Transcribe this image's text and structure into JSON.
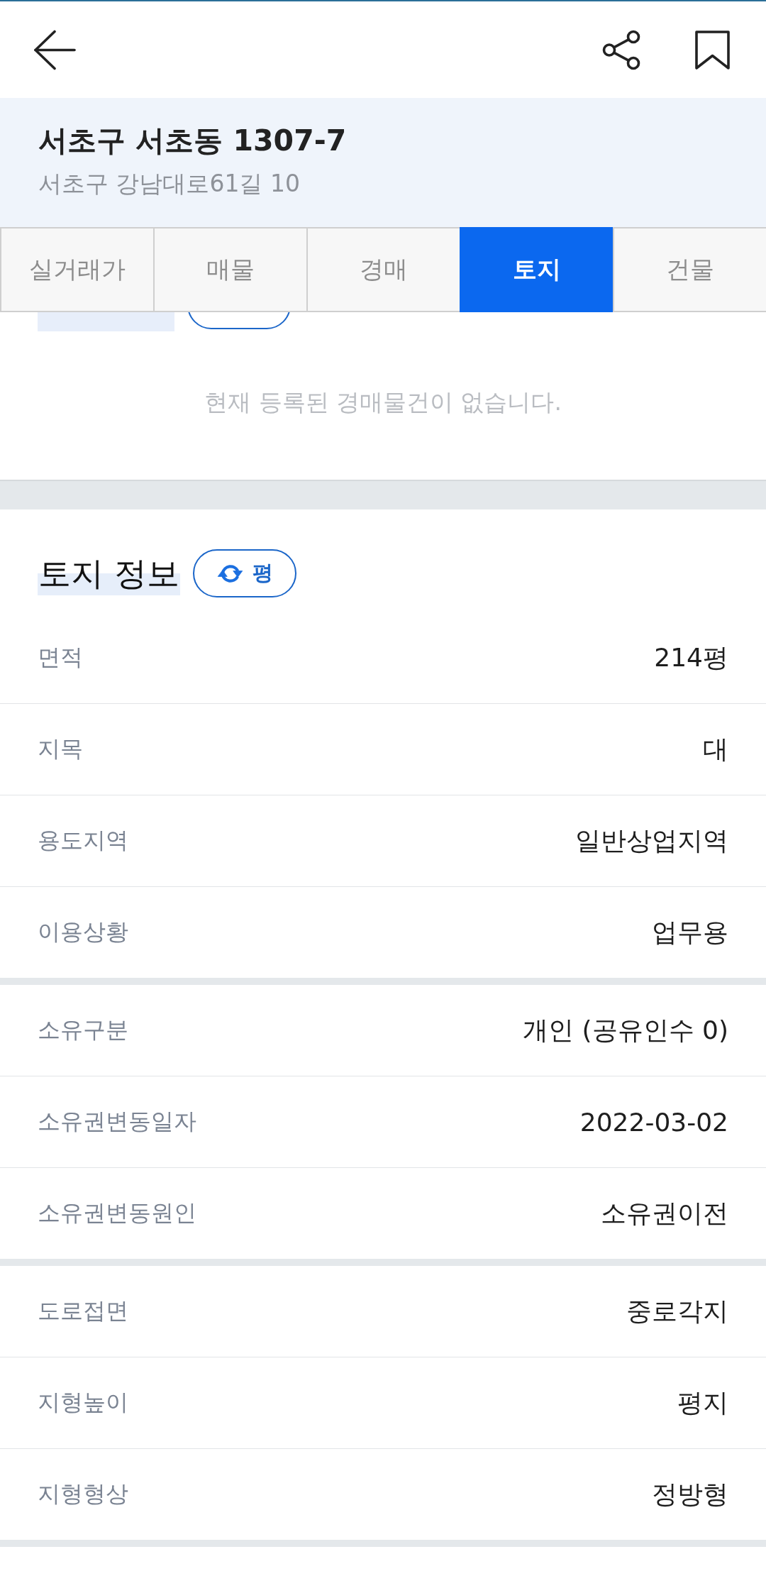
{
  "header": {
    "title": "서초구 서초동 1307-7",
    "address": "서초구 강남대로61길 10"
  },
  "tabs": [
    {
      "label": "실거래가",
      "selected": false
    },
    {
      "label": "매물",
      "selected": false
    },
    {
      "label": "경매",
      "selected": false
    },
    {
      "label": "토지",
      "selected": true
    },
    {
      "label": "건물",
      "selected": false
    }
  ],
  "auction_section": {
    "empty_message": "현재 등록된 경매물건이 없습니다."
  },
  "land_info": {
    "title": "토지 정보",
    "unit_button": {
      "label": "평"
    },
    "groups": [
      {
        "rows": [
          {
            "label": "면적",
            "value": "214평"
          },
          {
            "label": "지목",
            "value": "대"
          },
          {
            "label": "용도지역",
            "value": "일반상업지역"
          },
          {
            "label": "이용상황",
            "value": "업무용"
          }
        ]
      },
      {
        "rows": [
          {
            "label": "소유구분",
            "value": "개인 (공유인수 0)"
          },
          {
            "label": "소유권변동일자",
            "value": "2022-03-02"
          },
          {
            "label": "소유권변동원인",
            "value": "소유권이전"
          }
        ]
      },
      {
        "rows": [
          {
            "label": "도로접면",
            "value": "중로각지"
          },
          {
            "label": "지형높이",
            "value": "평지"
          },
          {
            "label": "지형형상",
            "value": "정방형"
          }
        ]
      }
    ]
  }
}
